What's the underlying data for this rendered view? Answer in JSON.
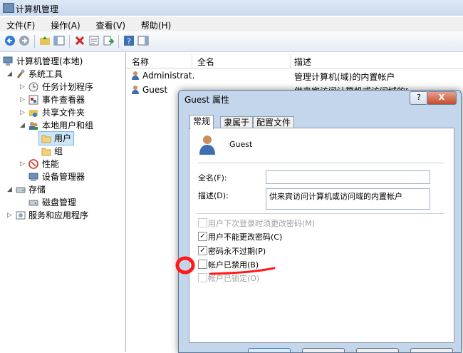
{
  "window": {
    "title": "计算机管理"
  },
  "menu": [
    "文件(F)",
    "操作(A)",
    "查看(V)",
    "帮助(H)"
  ],
  "tree": {
    "root": "计算机管理(本地)",
    "system_tools": "系统工具",
    "task_scheduler": "任务计划程序",
    "event_viewer": "事件查看器",
    "shared_folders": "共享文件夹",
    "local_users_groups": "本地用户和组",
    "users": "用户",
    "groups": "组",
    "performance": "性能",
    "device_manager": "设备管理器",
    "storage": "存储",
    "disk_management": "磁盘管理",
    "services_apps": "服务和应用程序"
  },
  "list": {
    "columns": {
      "name": "名称",
      "fullname": "全名",
      "description": "描述"
    },
    "rows": [
      {
        "name": "Administrat...",
        "fullname": "",
        "description": "管理计算机(域)的内置帐户"
      },
      {
        "name": "Guest",
        "fullname": "",
        "description": "供来宾访问计算机或访问域的内"
      }
    ]
  },
  "dialog": {
    "title": "Guest 属性",
    "help": "?",
    "close": "X",
    "tabs": [
      "常规",
      "隶属于",
      "配置文件"
    ],
    "username": "Guest",
    "fullname_label": "全名(F):",
    "fullname_value": "",
    "description_label": "描述(D):",
    "description_value": "供来宾访问计算机或访问域的内置帐户",
    "checkboxes": [
      {
        "label": "用户下次登录时须更改密码(M)",
        "checked": false,
        "disabled": true
      },
      {
        "label": "用户不能更改密码(C)",
        "checked": true,
        "disabled": false
      },
      {
        "label": "密码永不过期(P)",
        "checked": true,
        "disabled": false
      },
      {
        "label": "帐户已禁用(B)",
        "checked": false,
        "disabled": false
      },
      {
        "label": "帐户已锁定(O)",
        "checked": false,
        "disabled": true
      }
    ]
  },
  "colors": {
    "annotation": "#ff1a1a",
    "selection": "#cde6f7"
  }
}
